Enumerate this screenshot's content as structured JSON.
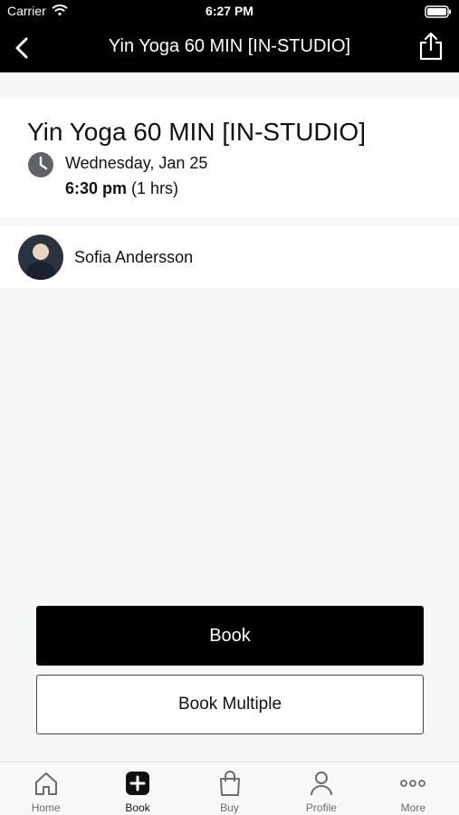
{
  "status_bar": {
    "carrier": "Carrier",
    "time": "6:27 PM"
  },
  "nav": {
    "title": "Yin Yoga 60 MIN [IN-STUDIO]"
  },
  "class_info": {
    "title": "Yin Yoga 60 MIN [IN-STUDIO]",
    "date": "Wednesday, Jan 25",
    "start_time": "6:30 pm",
    "duration": "(1 hrs)"
  },
  "instructor": {
    "name": "Sofia Andersson"
  },
  "actions": {
    "book_label": "Book",
    "book_multiple_label": "Book Multiple"
  },
  "tab_bar": {
    "items": [
      {
        "label": "Home",
        "icon": "home-icon"
      },
      {
        "label": "Book",
        "icon": "plus-square-icon"
      },
      {
        "label": "Buy",
        "icon": "shopping-bag-icon"
      },
      {
        "label": "Profile",
        "icon": "person-icon"
      },
      {
        "label": "More",
        "icon": "ellipsis-icon"
      }
    ],
    "active": "Book"
  }
}
